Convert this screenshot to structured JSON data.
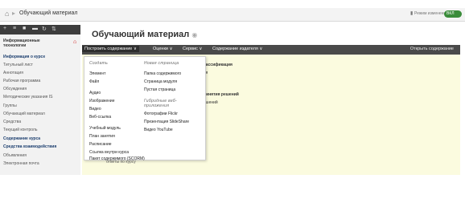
{
  "breadcrumb": {
    "current": "Обучающий материал"
  },
  "topbar": {
    "right_label": "Режим изменений",
    "toggle_label": "ВКЛ"
  },
  "sidebar": {
    "heading": "Информационные технологии",
    "items": [
      "Информация о курсе",
      "Титульный лист",
      "Аннотация",
      "Рабочая программа",
      "Обсуждения",
      "Методические указания IS",
      "Группы",
      "Обучающий материал",
      "Средства",
      "Текущий контроль",
      "Содержание курса",
      "Средства взаимодействия",
      "Объявления",
      "Электронная почта"
    ]
  },
  "page": {
    "title": "Обучающий материал"
  },
  "action_bar": {
    "menus": [
      "Построить содержание",
      "Оценки",
      "Сервис",
      "Содержание издателя"
    ],
    "right_button": "Открыть содержание"
  },
  "content": {
    "t1": "классификация",
    "t1b": "ция",
    "t2": "принятия решений",
    "t2b": "решений",
    "t3": "ия",
    "t4": "ответы по курсу"
  },
  "dropdown": {
    "col1_heading": "Создать",
    "col1_items": [
      "Элемент",
      "Файл",
      "Аудио",
      "Изображение",
      "Видео",
      "Веб-ссылка",
      "Учебный модуль",
      "План занятия",
      "Расписание",
      "Ссылка внутри курса",
      "Пакет содержимого (SCORM)"
    ],
    "col2_heading": "Новая страница",
    "col2_items": [
      "Папка содержимого",
      "Страница модуля",
      "Пустая страница"
    ],
    "col3_heading": "Гибридные веб-приложения",
    "col3_items": [
      "Фотографии Flickr",
      "Презентация SlideShare",
      "Видео YouTube"
    ]
  }
}
